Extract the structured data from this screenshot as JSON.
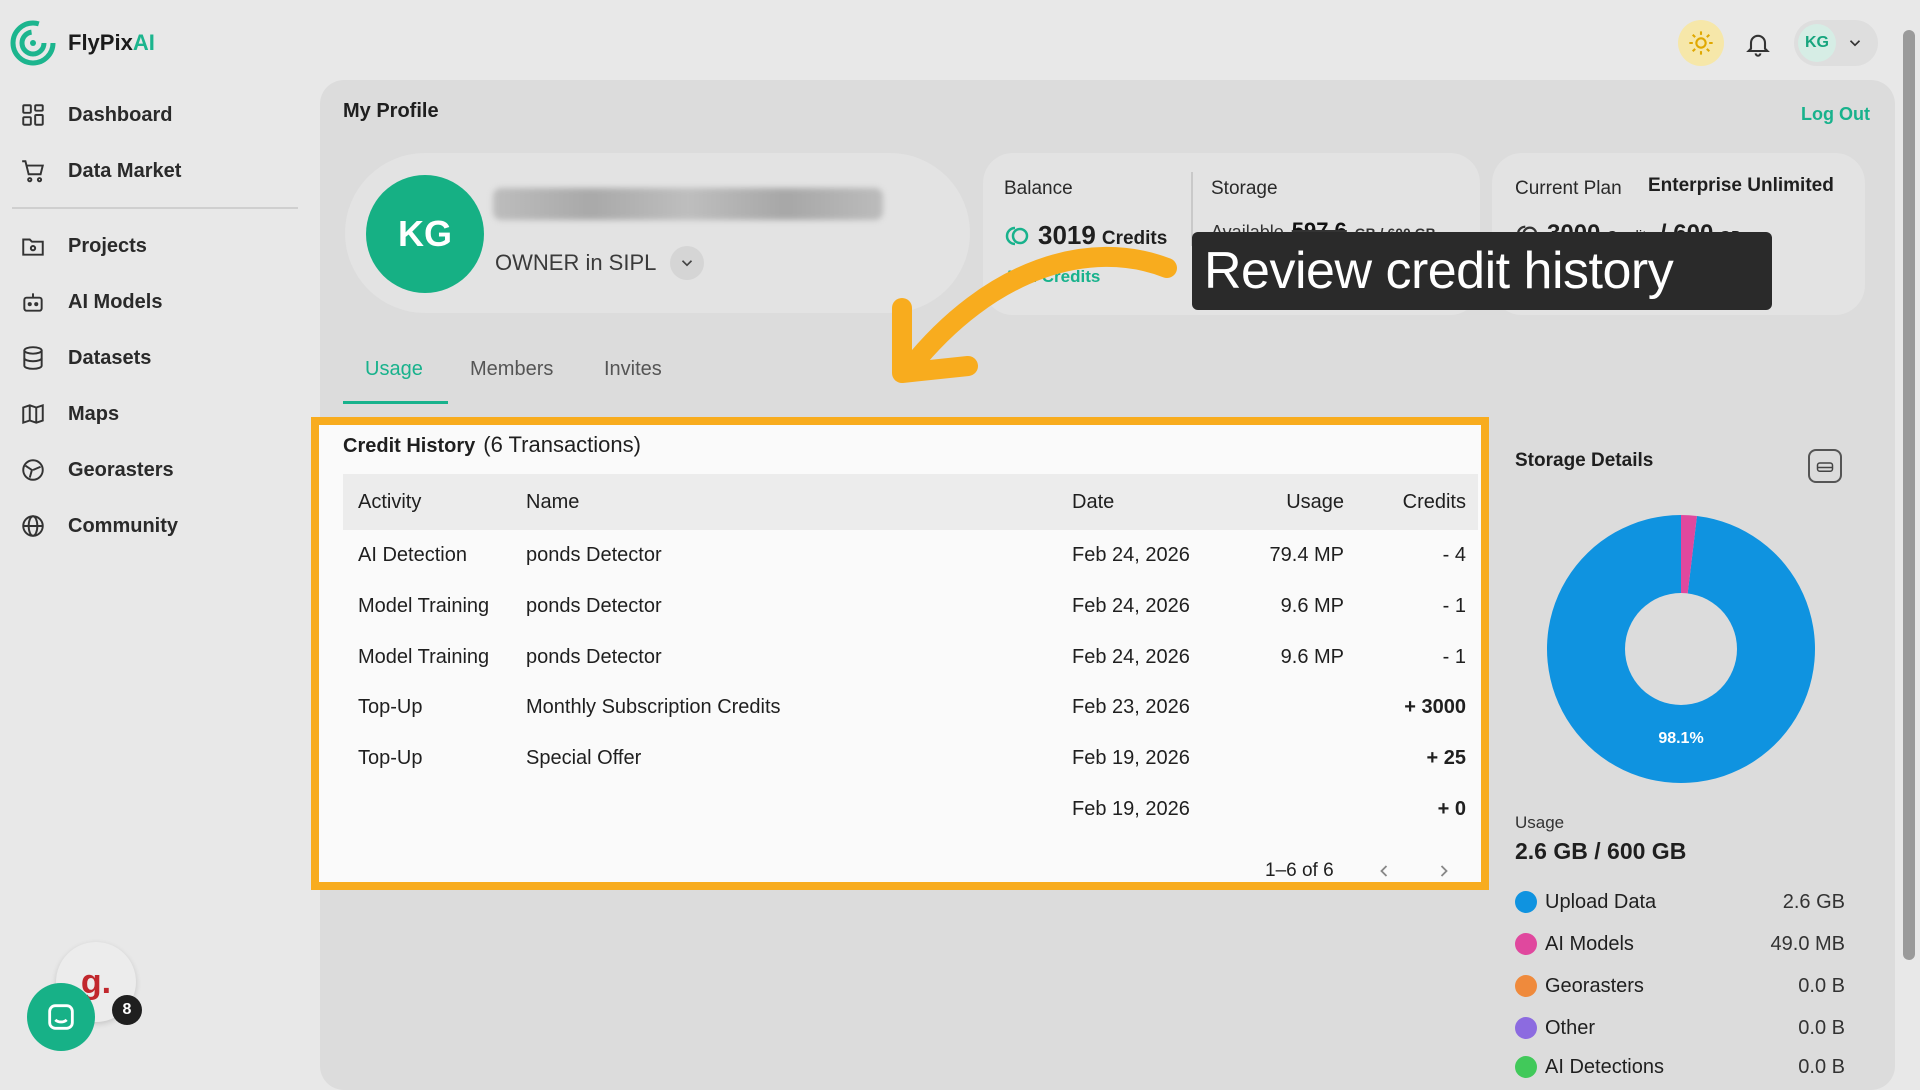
{
  "brand": {
    "name_main": "FlyPix",
    "name_accent": "AI",
    "accent_color": "#1cb58e"
  },
  "sidebar": {
    "items": [
      {
        "label": "Dashboard",
        "icon": "grid-icon"
      },
      {
        "label": "Data Market",
        "icon": "cart-icon"
      },
      {
        "label": "Projects",
        "icon": "folder-icon"
      },
      {
        "label": "AI Models",
        "icon": "robot-icon"
      },
      {
        "label": "Datasets",
        "icon": "database-icon"
      },
      {
        "label": "Maps",
        "icon": "map-icon"
      },
      {
        "label": "Georasters",
        "icon": "satellite-icon"
      },
      {
        "label": "Community",
        "icon": "globe-icon"
      }
    ]
  },
  "header": {
    "user_initials": "KG"
  },
  "page": {
    "title": "My Profile",
    "logout": "Log Out"
  },
  "profile": {
    "initials": "KG",
    "role": "OWNER in SIPL"
  },
  "balance": {
    "label": "Balance",
    "credits": "3019",
    "credits_unit": "Credits",
    "add_credits": "Add Credits"
  },
  "storage": {
    "label": "Storage",
    "available_label": "Available",
    "available_value": "597.6",
    "available_unit": "GB / 600 GB"
  },
  "plan": {
    "label": "Current Plan",
    "name": "Enterprise Unlimited",
    "credits": "3000",
    "credits_unit": "Credits",
    "separator": "/ 600",
    "unit": "GB"
  },
  "tabs": [
    {
      "label": "Usage"
    },
    {
      "label": "Members"
    },
    {
      "label": "Invites"
    }
  ],
  "callout": {
    "text": "Review credit history"
  },
  "credit_history": {
    "title": "Credit History",
    "count": "(6 Transactions)",
    "columns": {
      "activity": "Activity",
      "name": "Name",
      "date": "Date",
      "usage": "Usage",
      "credits": "Credits"
    },
    "rows": [
      {
        "activity": "AI Detection",
        "name": "ponds Detector",
        "date": "Feb 24, 2026",
        "usage": "79.4 MP",
        "credits": "- 4"
      },
      {
        "activity": "Model Training",
        "name": "ponds Detector",
        "date": "Feb 24, 2026",
        "usage": "9.6 MP",
        "credits": "- 1"
      },
      {
        "activity": "Model Training",
        "name": "ponds Detector",
        "date": "Feb 24, 2026",
        "usage": "9.6 MP",
        "credits": "- 1"
      },
      {
        "activity": "Top-Up",
        "name": "Monthly Subscription Credits",
        "date": "Feb 23, 2026",
        "usage": "",
        "credits": "+ 3000"
      },
      {
        "activity": "Top-Up",
        "name": "Special Offer",
        "date": "Feb 19, 2026",
        "usage": "",
        "credits": "+ 25"
      },
      {
        "activity": "",
        "name": "",
        "date": "Feb 19, 2026",
        "usage": "",
        "credits": "+ 0"
      }
    ],
    "pagination": "1–6 of 6"
  },
  "storage_details": {
    "title": "Storage Details",
    "donut_label": "98.1%",
    "usage_label": "Usage",
    "usage_value": "2.6 GB / 600 GB",
    "legend": [
      {
        "label": "Upload Data",
        "value": "2.6 GB",
        "color": "#0f93e0"
      },
      {
        "label": "AI Models",
        "value": "49.0 MB",
        "color": "#e0489e"
      },
      {
        "label": "Georasters",
        "value": "0.0 B",
        "color": "#ef8a3c"
      },
      {
        "label": "Other",
        "value": "0.0 B",
        "color": "#8c6be0"
      },
      {
        "label": "AI Detections",
        "value": "0.0 B",
        "color": "#41c95a"
      }
    ],
    "chart_data": {
      "type": "pie",
      "categories": [
        "Upload Data",
        "AI Models"
      ],
      "values": [
        98.1,
        1.9
      ],
      "colors": [
        "#0f93e0",
        "#e0489e"
      ]
    }
  },
  "widgets": {
    "g_letter": "g.",
    "notification_count": "8"
  }
}
